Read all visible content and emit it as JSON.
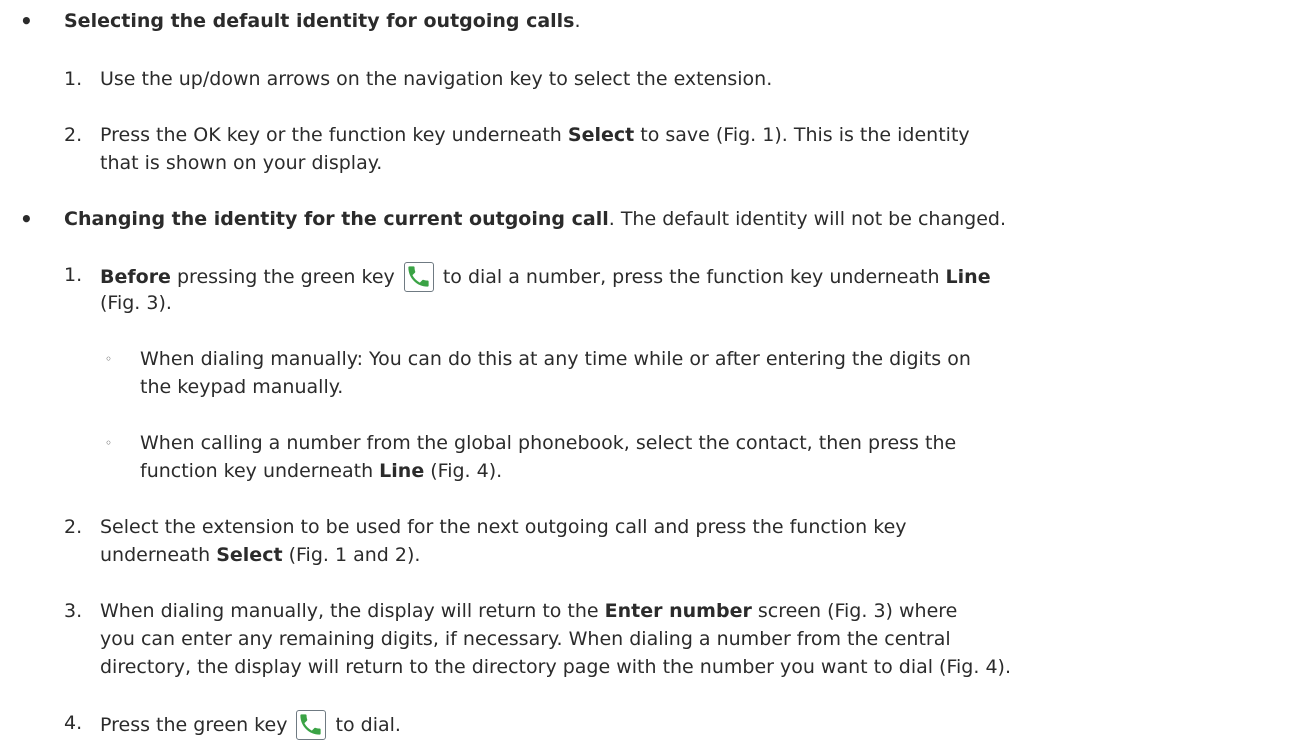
{
  "s1": {
    "title": "Selecting the default identity for outgoing calls",
    "title_end": ".",
    "step1": {
      "num": "1.",
      "text": "Use the up/down arrows on the navigation key to select the extension."
    },
    "step2": {
      "num": "2.",
      "pre": "Press the OK key or the function key underneath ",
      "bold": "Select",
      "post": " to save (Fig. 1).  This is the identity",
      "line2": "that is shown on your display."
    }
  },
  "s2": {
    "title": "Changing the identity for the current outgoing call",
    "title_post": ".  The default identity will not be changed.",
    "step1": {
      "num": "1.",
      "bold1": "Before",
      "pre": " pressing the green key ",
      "mid": " to dial a number, press the function key underneath ",
      "bold2": "Line",
      "line2": "(Fig. 3)."
    },
    "sub1": {
      "line1": "When dialing manually:  You can do this at any time while or after entering the digits on",
      "line2": "the keypad manually."
    },
    "sub2": {
      "line1": "When calling a number from the global phonebook, select the contact, then press the",
      "line2_pre": "function key underneath ",
      "line2_bold": "Line",
      "line2_post": " (Fig. 4)."
    },
    "step2": {
      "num": "2.",
      "line1": "Select the extension to be used for the next outgoing call and press the function key",
      "line2_pre": "underneath ",
      "line2_bold": "Select",
      "line2_post": " (Fig. 1 and 2)."
    },
    "step3": {
      "num": "3.",
      "l1_pre": "When dialing manually, the display will return to the ",
      "l1_bold": "Enter number",
      "l1_post": " screen (Fig. 3) where",
      "line2": "you can enter any remaining digits, if necessary.  When dialing a number from the central",
      "line3": "directory, the display will return to the directory page with the number you want to dial (Fig. 4)."
    },
    "step4": {
      "num": "4.",
      "pre": "Press the green key ",
      "post": " to dial."
    }
  },
  "icons": {
    "call_key": "green-phone-handset-icon",
    "accent": "#3aa345",
    "bullet": "•",
    "sub_bullet": "◦"
  }
}
